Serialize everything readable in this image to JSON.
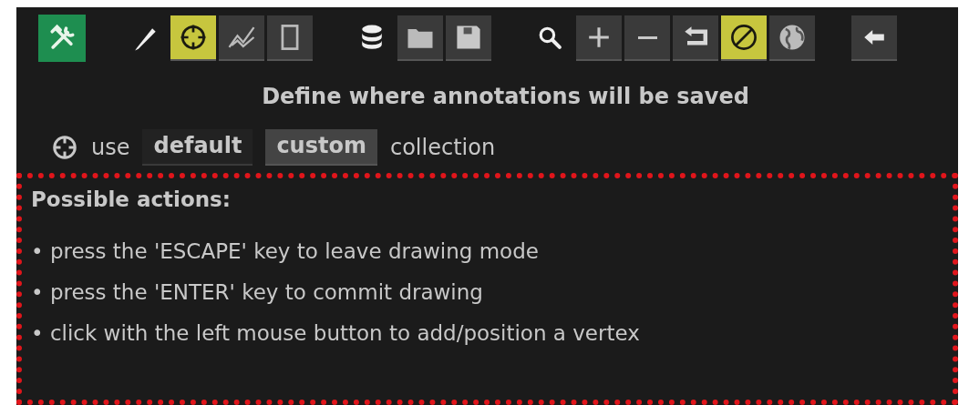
{
  "toolbar": [
    [
      {
        "kind": "menu",
        "selected": true
      }
    ],
    [
      {
        "kind": "plain"
      },
      {
        "kind": "toggle",
        "selected": true
      },
      {
        "kind": "toggle",
        "selected": false
      },
      {
        "kind": "toggle",
        "selected": false
      }
    ],
    [
      {
        "kind": "plain"
      },
      {
        "kind": "toggle",
        "selected": false
      },
      {
        "kind": "toggle",
        "selected": false
      }
    ],
    [
      {
        "kind": "plain"
      },
      {
        "kind": "toggle",
        "selected": false
      },
      {
        "kind": "toggle",
        "selected": false
      },
      {
        "kind": "toggle",
        "selected": false
      },
      {
        "kind": "toggle",
        "selected": true
      },
      {
        "kind": "toggle",
        "selected": false
      }
    ],
    [
      {
        "kind": "toggle",
        "selected": false
      }
    ]
  ],
  "heading": "Define where annotations will be saved",
  "collection": {
    "prefix": "use",
    "options": [
      {
        "label": "default",
        "selected": false
      },
      {
        "label": "custom",
        "selected": true
      }
    ],
    "suffix": "collection"
  },
  "help": {
    "title": "Possible actions:",
    "items": [
      "• press the 'ESCAPE' key to leave drawing mode",
      "• press the 'ENTER' key to commit drawing",
      "• click with the left mouse button to add/position a vertex"
    ]
  }
}
